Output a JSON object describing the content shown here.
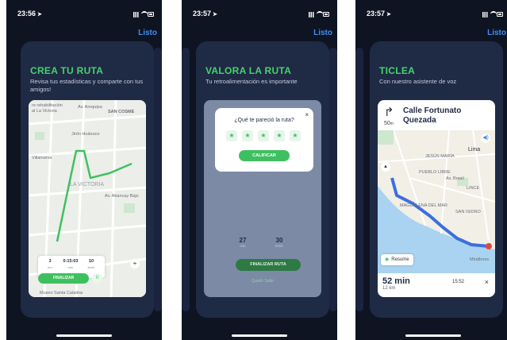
{
  "colors": {
    "accent_green": "#46d36b",
    "card_bg": "#1f2a45",
    "link_blue": "#3d8ef8",
    "phone_bg": "#0f1422"
  },
  "icons": [
    "location-arrow-icon",
    "signal-icon",
    "wifi-icon",
    "battery-icon",
    "close-icon",
    "star-icon",
    "pause-icon",
    "target-icon",
    "turn-right-icon",
    "sound-icon",
    "compass-icon",
    "resume-icon",
    "map-pin-icon"
  ],
  "screens": [
    {
      "time": "23:56",
      "done": "Listo",
      "title": "CREA TU RUTA",
      "subtitle": "Revisa tus estadísticas y comparte con tus amigos!",
      "map_labels": [
        "re rehabilitación",
        "al La Victoria",
        "Av. Arequipa",
        "SAN COSME",
        "Villanueva",
        "Jirón Huánuco",
        "Av. Abancay Bajo",
        "LA VICTORIA",
        "Museo Santa Catalina"
      ],
      "stats": [
        {
          "value": "3",
          "unit": "km"
        },
        {
          "value": "0:15:03",
          "unit": "min"
        },
        {
          "value": "10",
          "unit": "km/h"
        }
      ],
      "finish": "FINALIZAR",
      "pause": "II"
    },
    {
      "time": "23:57",
      "done": "Listo",
      "title": "VALORA LA RUTA",
      "subtitle": "Tu retroalimentación es importante",
      "question": "¿Qué te pareció la ruta?",
      "star": "★",
      "rate_button": "CALIFICAR",
      "close": "×",
      "stats": [
        {
          "value": "27",
          "unit": "min"
        },
        {
          "value": "30",
          "unit": "km/h"
        }
      ],
      "finish": "FINALIZAR RUTA",
      "saved": "Quedó Subir"
    },
    {
      "time": "23:57",
      "done": "Listo",
      "title": "TICLEA",
      "subtitle": "Con nuestro asistente de voz",
      "street": "Calle Fortunato Quezada",
      "distance": "50",
      "distance_unit": "m",
      "map_labels": [
        "Lima",
        "PUEBLO LIBRE",
        "LINCE",
        "SAN ISIDRO",
        "MAGDALENA DEL MAR",
        "JESÚS MARÍA",
        "Miraflores",
        "Av. Brasil"
      ],
      "resume": "Resume",
      "eta": "52 min",
      "km": "12 km",
      "arrival": "15:52",
      "close": "×"
    }
  ]
}
